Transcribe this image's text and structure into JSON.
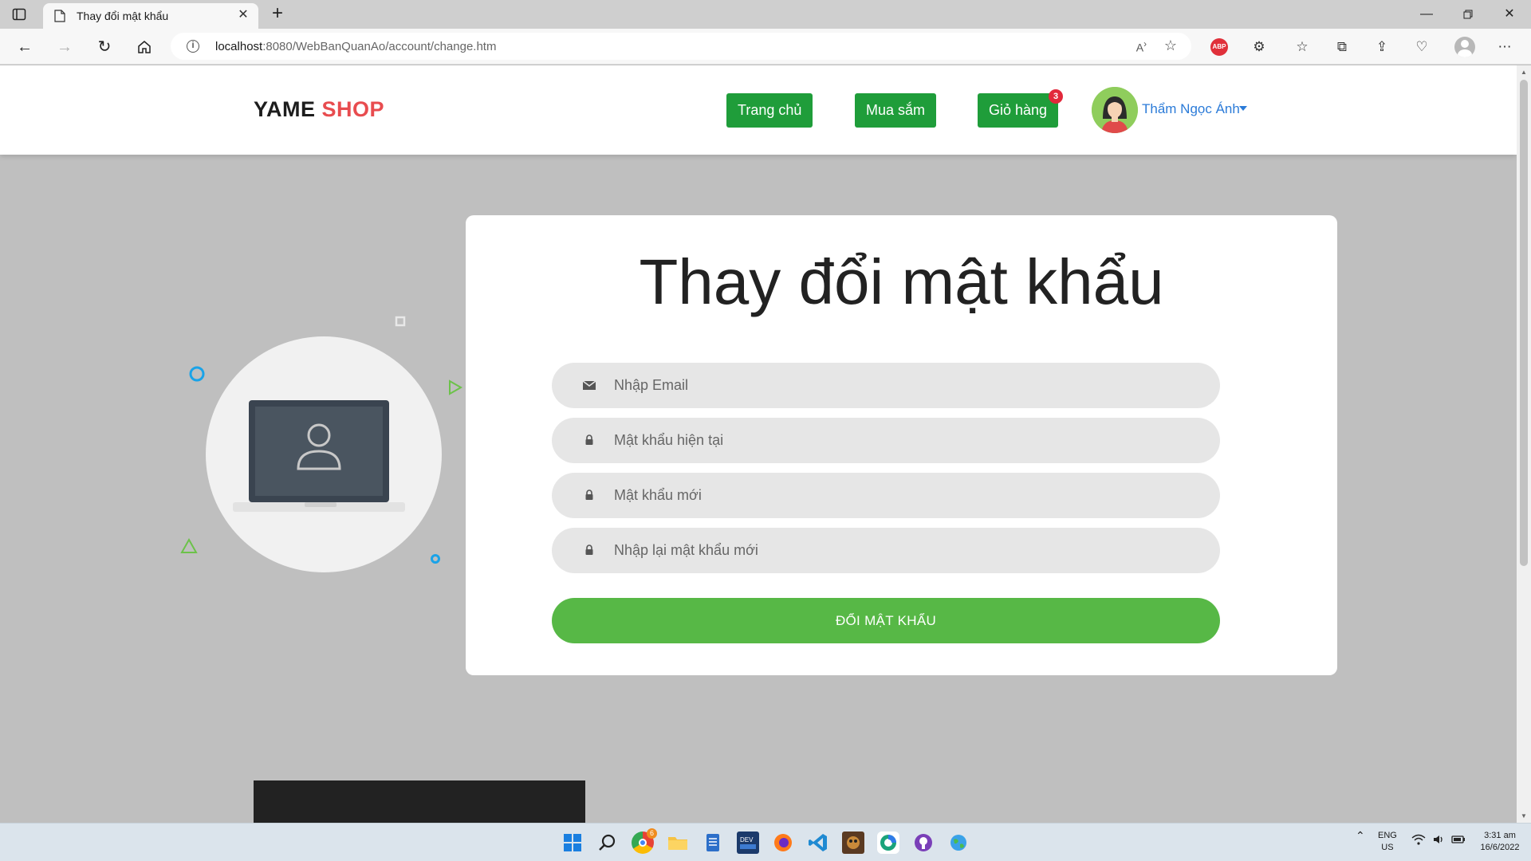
{
  "browser": {
    "tab_title": "Thay đổi mật khẩu",
    "url_host": "localhost",
    "url_rest": ":8080/WebBanQuanAo/account/change.htm",
    "new_tab_glyph": "+",
    "close_glyph": "✕"
  },
  "header": {
    "brand_main": "YAME",
    "brand_accent": "SHOP",
    "nav": [
      {
        "label": "Trang chủ"
      },
      {
        "label": "Mua sắm"
      },
      {
        "label": "Giỏ hàng",
        "badge": "3"
      }
    ],
    "user_name": "Thẩm Ngọc Ánh"
  },
  "form": {
    "title": "Thay đổi mật khẩu",
    "fields": [
      {
        "placeholder": "Nhập Email",
        "icon": "envelope-icon"
      },
      {
        "placeholder": "Mật khẩu hiện tại",
        "icon": "lock-icon"
      },
      {
        "placeholder": "Mật khẩu mới",
        "icon": "lock-icon"
      },
      {
        "placeholder": "Nhập lại mật khẩu mới",
        "icon": "lock-icon"
      }
    ],
    "submit_label": "ĐỔI MẬT KHẨU"
  },
  "taskbar": {
    "lang_top": "ENG",
    "lang_bottom": "US",
    "time": "3:31 am",
    "date": "16/6/2022",
    "chrome_badge": "6"
  },
  "colors": {
    "primary_green": "#1f9d3a",
    "submit_green": "#57b846",
    "brand_red": "#e84c4f",
    "link_blue": "#2b7bd8",
    "badge_red": "#e2283b"
  }
}
